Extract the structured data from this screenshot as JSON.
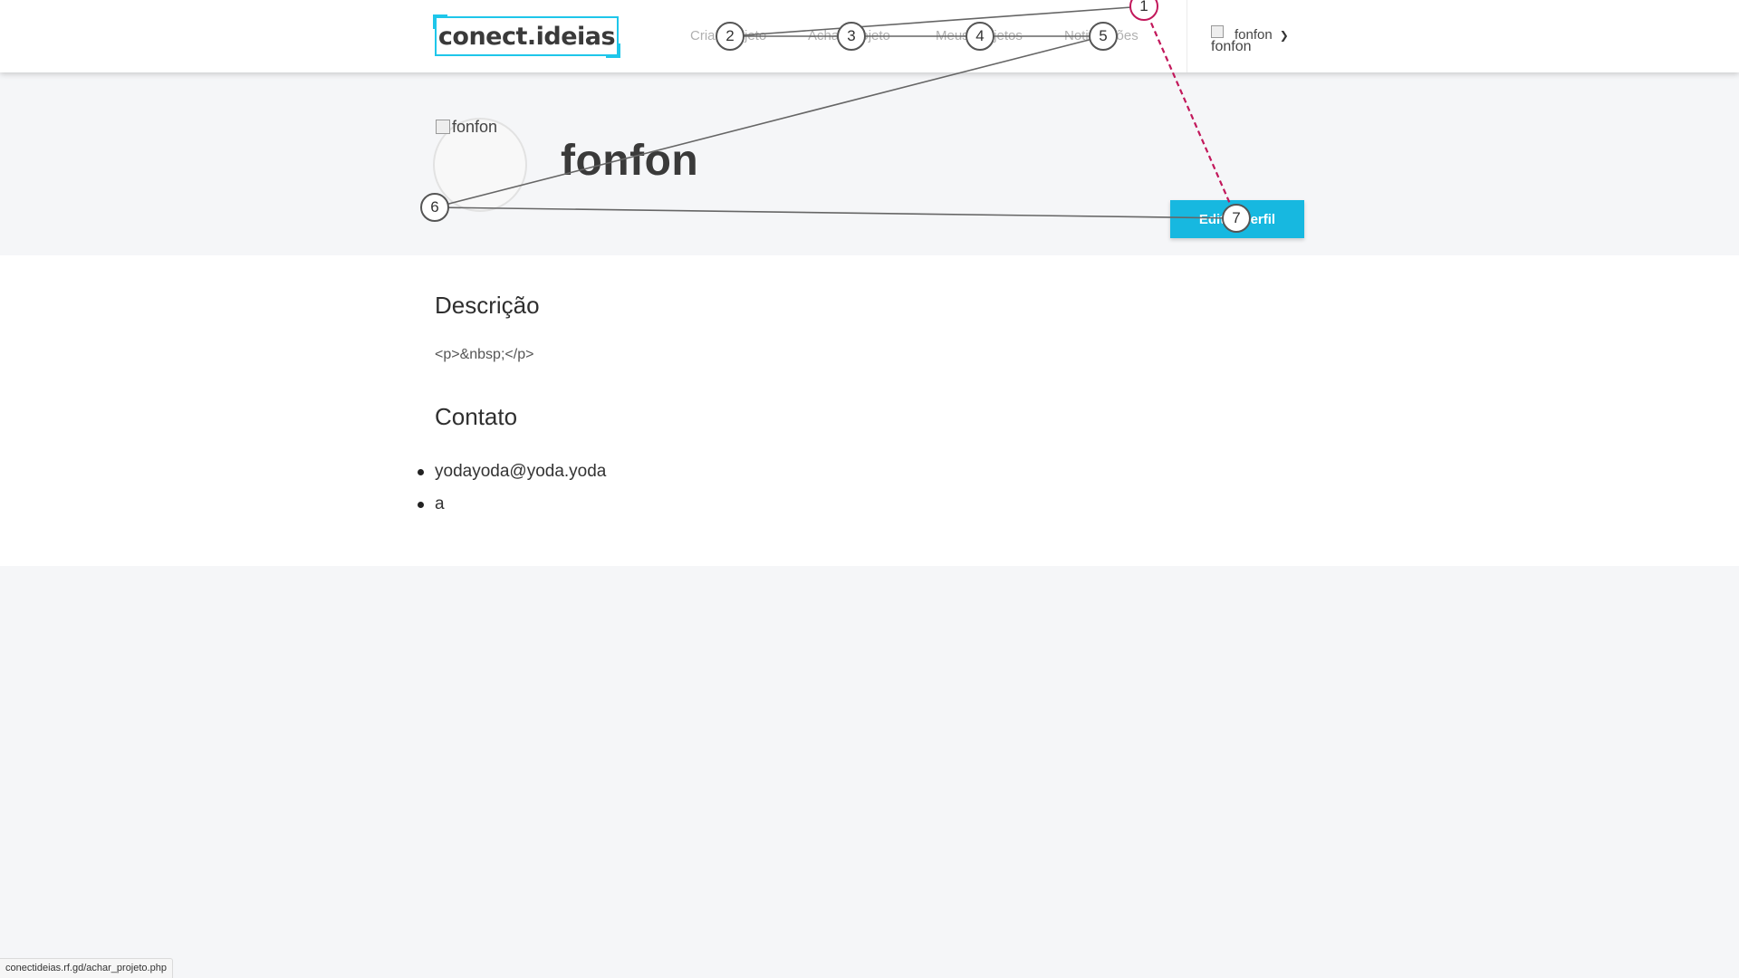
{
  "header": {
    "logo_text": "conect.ideias",
    "nav": [
      {
        "label": "Criar Projeto"
      },
      {
        "label": "Achar Projeto"
      },
      {
        "label": "Meus Projetos"
      },
      {
        "label": "Notificações"
      }
    ],
    "user": {
      "avatar_alt": "fonfon",
      "name": "fonfon",
      "caret_icon": "chevron-down-icon"
    }
  },
  "profile": {
    "avatar_alt": "fonfon",
    "name": "fonfon",
    "edit_button_label": "Editar Perfil"
  },
  "description": {
    "heading": "Descrição",
    "text": "<p>&nbsp;</p>"
  },
  "contact": {
    "heading": "Contato",
    "items": [
      "yodayoda@yoda.yoda",
      "a"
    ]
  },
  "annotations": {
    "markers": [
      "1",
      "2",
      "3",
      "4",
      "5",
      "6",
      "7"
    ],
    "line_color": "#555555",
    "highlight_color": "#c2185b"
  },
  "status_bar": {
    "url": "conectideias.rf.gd/achar_projeto.php"
  },
  "colors": {
    "accent": "#17b8e0",
    "logo_border": "#1ec6ea",
    "page_bg": "#f5f6f8"
  }
}
